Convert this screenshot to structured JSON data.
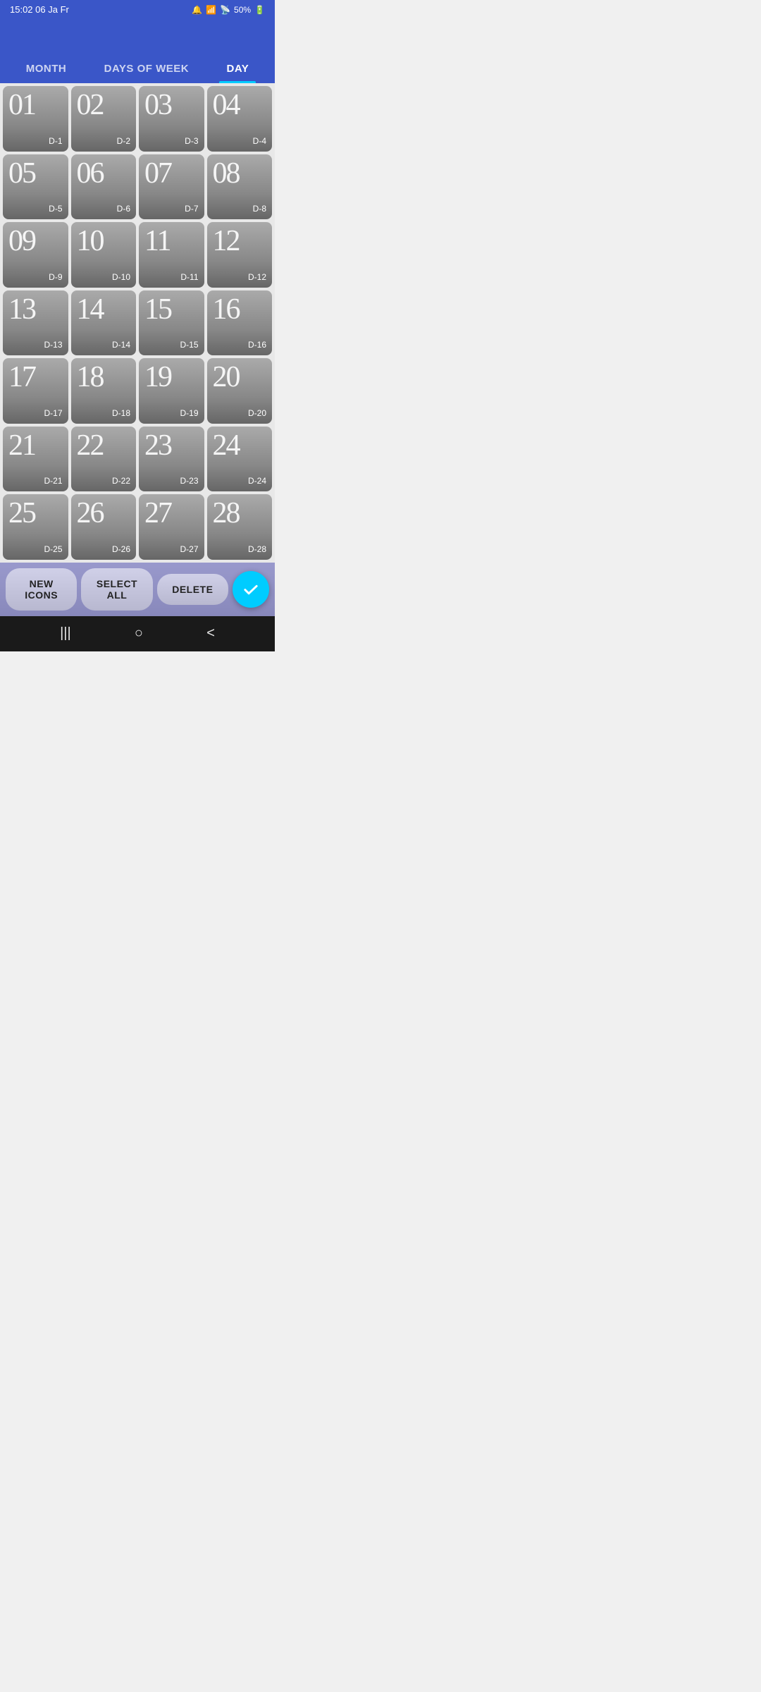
{
  "statusBar": {
    "time": "15:02",
    "date": "06 Ja Fr",
    "battery": "50%",
    "icons": [
      "alarm",
      "wifi",
      "signal",
      "battery"
    ]
  },
  "tabs": [
    {
      "label": "MONTH",
      "active": false
    },
    {
      "label": "DAYS OF WEEK",
      "active": false
    },
    {
      "label": "DAY",
      "active": true
    }
  ],
  "days": [
    {
      "number": "01",
      "label": "D-1"
    },
    {
      "number": "02",
      "label": "D-2"
    },
    {
      "number": "03",
      "label": "D-3"
    },
    {
      "number": "04",
      "label": "D-4"
    },
    {
      "number": "05",
      "label": "D-5"
    },
    {
      "number": "06",
      "label": "D-6"
    },
    {
      "number": "07",
      "label": "D-7"
    },
    {
      "number": "08",
      "label": "D-8"
    },
    {
      "number": "09",
      "label": "D-9"
    },
    {
      "number": "10",
      "label": "D-10"
    },
    {
      "number": "11",
      "label": "D-11"
    },
    {
      "number": "12",
      "label": "D-12"
    },
    {
      "number": "13",
      "label": "D-13"
    },
    {
      "number": "14",
      "label": "D-14"
    },
    {
      "number": "15",
      "label": "D-15"
    },
    {
      "number": "16",
      "label": "D-16"
    },
    {
      "number": "17",
      "label": "D-17"
    },
    {
      "number": "18",
      "label": "D-18"
    },
    {
      "number": "19",
      "label": "D-19"
    },
    {
      "number": "20",
      "label": "D-20"
    },
    {
      "number": "21",
      "label": "D-21"
    },
    {
      "number": "22",
      "label": "D-22"
    },
    {
      "number": "23",
      "label": "D-23"
    },
    {
      "number": "24",
      "label": "D-24"
    },
    {
      "number": "25",
      "label": "D-25"
    },
    {
      "number": "26",
      "label": "D-26"
    },
    {
      "number": "27",
      "label": "D-27"
    },
    {
      "number": "28",
      "label": "D-28"
    }
  ],
  "toolbar": {
    "new_icons_label": "NEW ICONS",
    "select_all_label": "SELECT ALL",
    "delete_label": "DELETE"
  },
  "nav": {
    "recent": "|||",
    "home": "○",
    "back": "<"
  }
}
